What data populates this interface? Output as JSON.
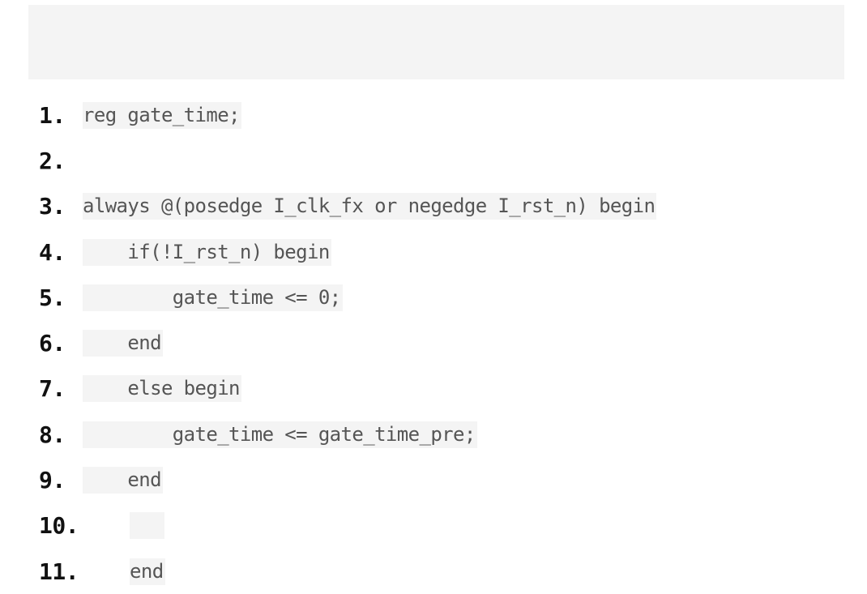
{
  "code": {
    "lines": [
      {
        "num": "1.",
        "text": "reg gate_time;"
      },
      {
        "num": "2.",
        "text": ""
      },
      {
        "num": "3.",
        "text": "always @(posedge I_clk_fx or negedge I_rst_n) begin"
      },
      {
        "num": "4.",
        "text": "    if(!I_rst_n) begin"
      },
      {
        "num": "5.",
        "text": "        gate_time <= 0;"
      },
      {
        "num": "6.",
        "text": "    end"
      },
      {
        "num": "7.",
        "text": "    else begin"
      },
      {
        "num": "8.",
        "text": "        gate_time <= gate_time_pre;"
      },
      {
        "num": "9.",
        "text": "    end"
      },
      {
        "num": "10.",
        "text": ""
      },
      {
        "num": "11.",
        "text": "end"
      }
    ]
  }
}
